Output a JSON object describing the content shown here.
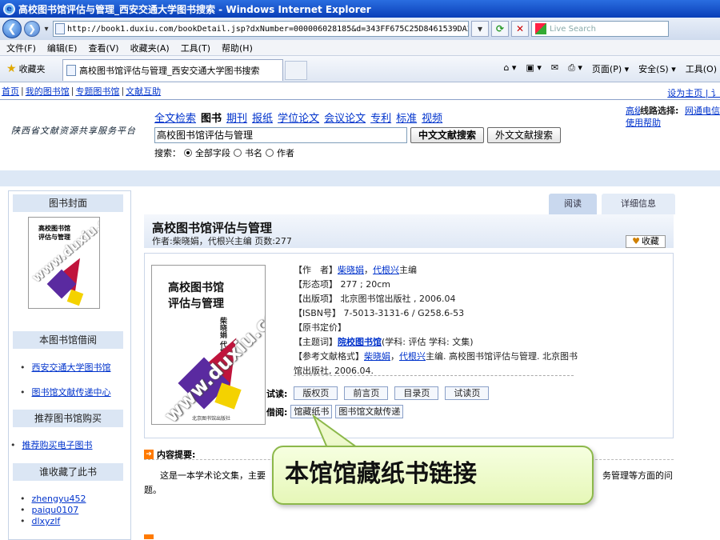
{
  "window": {
    "title": "高校图书馆评估与管理_西安交通大学图书搜索 - Windows Internet Explorer",
    "logo_glyph": "e"
  },
  "address": {
    "url": "http://book1.duxiu.com/bookDetail.jsp?dxNumber=000006028185&d=343FF675C25D8461539DA2E9E21(",
    "search_placeholder": "Live Search"
  },
  "menu": [
    "文件(F)",
    "编辑(E)",
    "查看(V)",
    "收藏夹(A)",
    "工具(T)",
    "帮助(H)"
  ],
  "favbar": {
    "favorites": "收藏夹",
    "tab_title": "高校图书馆评估与管理_西安交通大学图书搜索",
    "tools": [
      "页面(P) ▾",
      "安全(S) ▾",
      "工具(O)"
    ]
  },
  "sitenav": {
    "links": [
      "首页",
      "我的图书馆",
      "专题图书馆",
      "文献互助"
    ],
    "right": "设为主页 | 讠"
  },
  "header": {
    "logo_text": "陕西省文献资源共享服务平台",
    "types": [
      "全文检索",
      "图书",
      "期刊",
      "报纸",
      "学位论文",
      "会议论文",
      "专利",
      "标准",
      "视频"
    ],
    "query": "高校图书馆评估与管理",
    "btn_cn": "中文文献搜索",
    "btn_foreign": "外文文献搜索",
    "search_label": "搜索：",
    "radio_all": "全部字段",
    "radio_title": "书名",
    "radio_author": "作者",
    "right_label": "线路选择:",
    "right_link1": "高级搜索",
    "right_link2": "网通电信",
    "right_link3": "使用帮助"
  },
  "left": {
    "cover_head": "图书封面",
    "library_head": "本图书馆借阅",
    "library_links": [
      "西安交通大学图书馆",
      "图书馆文献传递中心"
    ],
    "recommend_head": "推荐图书馆购买",
    "recommend_link": "推荐购买电子图书",
    "who_head": "谁收藏了此书",
    "users": [
      "zhengyu452",
      "paiqu0107",
      "dlxyzlf"
    ]
  },
  "cover": {
    "title_l1": "高校图书馆",
    "title_l2": "评估与管理",
    "authors": "柴晓娟 代根兴 主编",
    "watermark": "www.duxiu.com",
    "publisher": "北京图书馆出版社"
  },
  "book": {
    "tabs": [
      "阅读",
      "详细信息"
    ],
    "title": "高校图书馆评估与管理",
    "meta": "作者:柴晓娟，代根兴主编   页数:277",
    "collect": "收藏",
    "author_label": "【作　者】",
    "author1": "柴晓娟",
    "author_sep": "，",
    "author2": "代根兴",
    "author_suffix": "主编",
    "form": "【形态项】 277 ; 20cm",
    "publish": "【出版项】 北京图书馆出版社 , 2006.04",
    "isbn": "【ISBN号】 7-5013-3131-6 / G258.6-53",
    "price": "【原书定价】",
    "subject_label": "【主题词】",
    "subject_link": "院校图书馆",
    "subject_rest": "(学科: 评估 学科: 文集)",
    "ref_label": "【参考文献格式】",
    "ref_rest": "主编. 高校图书馆评估与管理. 北京图书馆出版社, 2006.04.",
    "trial_label": "试读:",
    "trial_pages": [
      "版权页",
      "前言页",
      "目录页",
      "试读页"
    ],
    "borrow_label": "借阅:",
    "borrow_btns": [
      "馆藏纸书",
      "图书馆文献传递"
    ],
    "summary_head": "内容提要:",
    "summary_a": "这是一本学术论文集，主要",
    "summary_b": "务管理等方面的问",
    "summary_c": "题。"
  },
  "callout": {
    "text": "本馆馆藏纸书链接"
  },
  "colors": {
    "accent": "#0033cc",
    "callout_bg": "#eef9cc",
    "callout_border": "#8cb84a"
  }
}
